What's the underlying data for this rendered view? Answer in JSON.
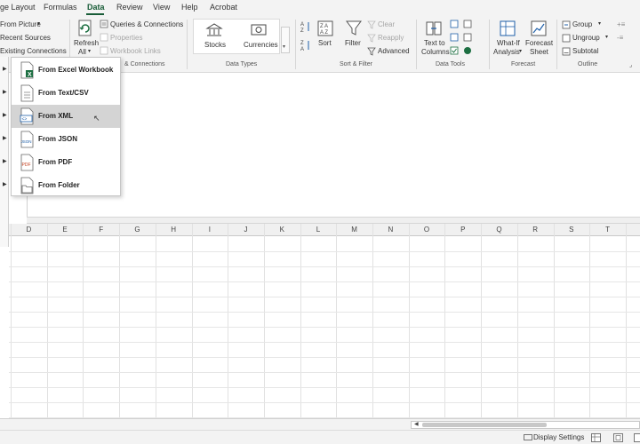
{
  "menu": {
    "tabs": [
      "ge Layout",
      "Formulas",
      "Data",
      "Review",
      "View",
      "Help",
      "Acrobat"
    ],
    "active": "Data"
  },
  "ribbon": {
    "get_data": {
      "from_picture": "From Picture",
      "recent_sources": "Recent Sources",
      "existing_connections": "Existing Connections"
    },
    "queries": {
      "refresh": "Refresh",
      "refresh_all": "All",
      "queries_connections": "Queries & Connections",
      "properties": "Properties",
      "workbook_links": "Workbook Links",
      "group_label": "& Connections"
    },
    "data_types": {
      "stocks": "Stocks",
      "currencies": "Currencies",
      "group_label": "Data Types"
    },
    "sort_filter": {
      "sort": "Sort",
      "filter": "Filter",
      "clear": "Clear",
      "reapply": "Reapply",
      "advanced": "Advanced",
      "group_label": "Sort & Filter"
    },
    "data_tools": {
      "text_to": "Text to",
      "columns": "Columns",
      "group_label": "Data Tools"
    },
    "forecast": {
      "what_if": "What-If",
      "analysis": "Analysis",
      "forecast": "Forecast",
      "sheet": "Sheet",
      "group_label": "Forecast"
    },
    "outline": {
      "group": "Group",
      "ungroup": "Ungroup",
      "subtotal": "Subtotal",
      "group_label": "Outline"
    }
  },
  "dropdown": {
    "items": [
      {
        "label": "From Excel Workbook",
        "icon": "excel-file-icon"
      },
      {
        "label": "From Text/CSV",
        "icon": "text-file-icon"
      },
      {
        "label": "From XML",
        "icon": "xml-file-icon"
      },
      {
        "label": "From JSON",
        "icon": "json-file-icon"
      },
      {
        "label": "From PDF",
        "icon": "pdf-file-icon"
      },
      {
        "label": "From Folder",
        "icon": "folder-file-icon"
      }
    ],
    "hovered_index": 2
  },
  "grid": {
    "columns": [
      "D",
      "E",
      "F",
      "G",
      "H",
      "I",
      "J",
      "K",
      "L",
      "M",
      "N",
      "O",
      "P",
      "Q",
      "R",
      "S",
      "T"
    ]
  },
  "status": {
    "display_settings": "Display Settings"
  },
  "colors": {
    "accent": "#185c37",
    "excel_green": "#1d6f42",
    "hover": "#d4d4d4"
  }
}
